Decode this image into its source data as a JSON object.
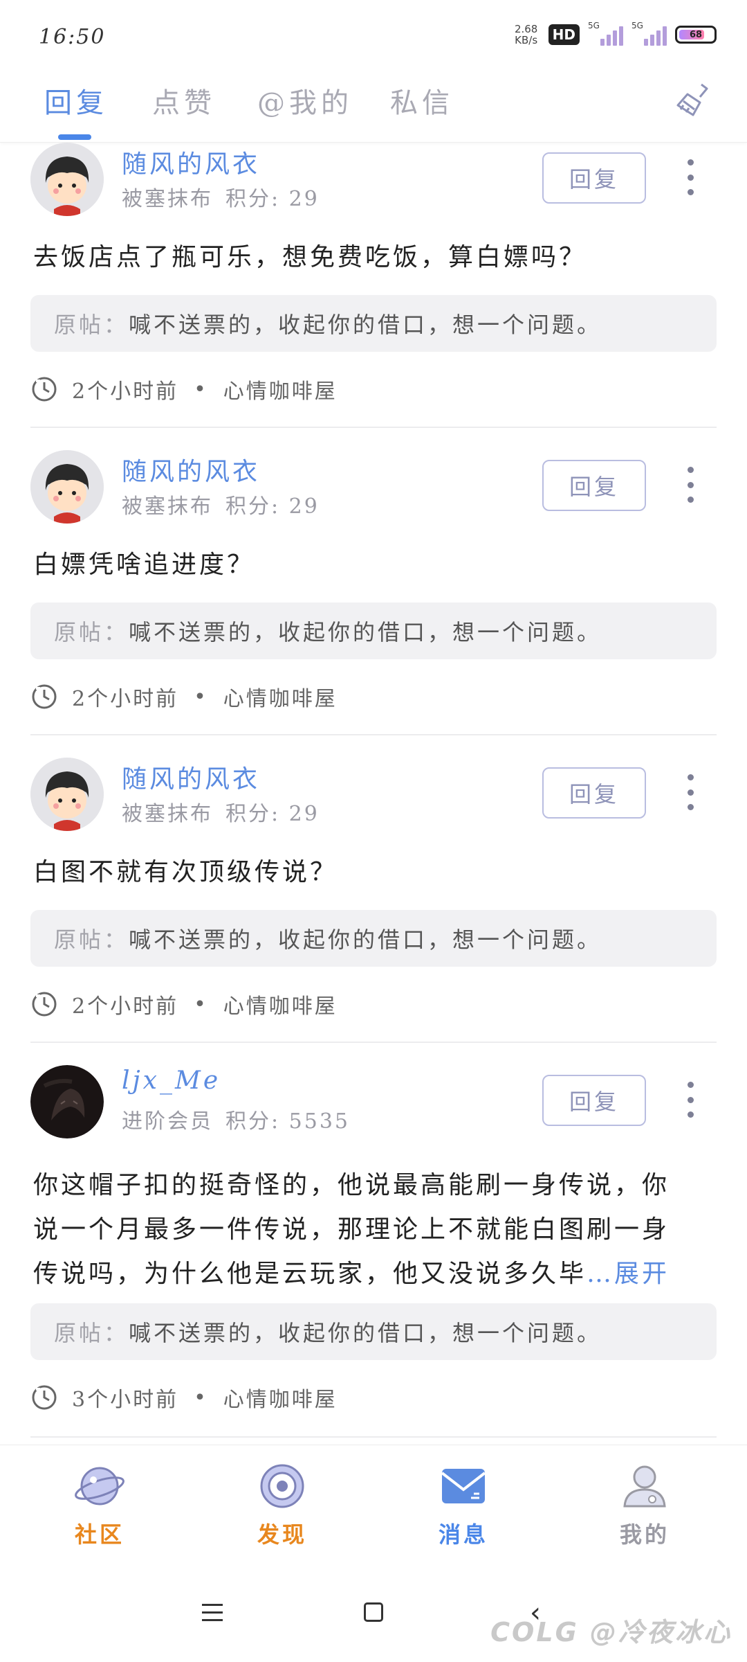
{
  "status_bar": {
    "time": "16:50",
    "net_speed_value": "2.68",
    "net_speed_unit": "KB/s",
    "hd_label": "HD",
    "sim1_label": "5G",
    "sim2_label": "5G",
    "battery_level": "68"
  },
  "tabs": [
    {
      "label": "回复",
      "active": true
    },
    {
      "label": "点赞",
      "active": false
    },
    {
      "label": "@我的",
      "active": false
    },
    {
      "label": "私信",
      "active": false
    }
  ],
  "colors": {
    "accent": "#5b8be0",
    "community": "#e8871e",
    "discover": "#e8871e",
    "messages": "#4a86e8",
    "mine": "#9a9aa3"
  },
  "posts": [
    {
      "username": "随风的风衣",
      "rank": "被塞抹布",
      "score": "积分: 29",
      "reply_label": "回复",
      "content": "去饭店点了瓶可乐，想免费吃饭，算白嫖吗？",
      "quote_prefix": "原帖：",
      "quote_text": "喊不送票的，收起你的借口，想一个问题。",
      "time": "2个小时前",
      "forum": "心情咖啡屋"
    },
    {
      "username": "随风的风衣",
      "rank": "被塞抹布",
      "score": "积分: 29",
      "reply_label": "回复",
      "content": "白嫖凭啥追进度？",
      "quote_prefix": "原帖：",
      "quote_text": "喊不送票的，收起你的借口，想一个问题。",
      "time": "2个小时前",
      "forum": "心情咖啡屋"
    },
    {
      "username": "随风的风衣",
      "rank": "被塞抹布",
      "score": "积分: 29",
      "reply_label": "回复",
      "content": "白图不就有次顶级传说？",
      "quote_prefix": "原帖：",
      "quote_text": "喊不送票的，收起你的借口，想一个问题。",
      "time": "2个小时前",
      "forum": "心情咖啡屋"
    },
    {
      "username": "ljx_Me",
      "rank": "进阶会员",
      "score": "积分: 5535",
      "reply_label": "回复",
      "content_lines": [
        "你这帽子扣的挺奇怪的，他说最高能刷一身传说，你",
        "说一个月最多一件传说，那理论上不就能白图刷一身",
        "传说吗，为什么他是云玩家，他又没说多久毕"
      ],
      "expand_label": "…展开",
      "quote_prefix": "原帖：",
      "quote_text": "喊不送票的，收起你的借口，想一个问题。",
      "time": "3个小时前",
      "forum": "心情咖啡屋"
    }
  ],
  "bottom_nav": [
    {
      "label": "社区",
      "icon": "planet-icon"
    },
    {
      "label": "发现",
      "icon": "target-icon"
    },
    {
      "label": "消息",
      "icon": "mail-icon"
    },
    {
      "label": "我的",
      "icon": "user-icon"
    }
  ],
  "watermark": "COLG @冷夜冰心"
}
